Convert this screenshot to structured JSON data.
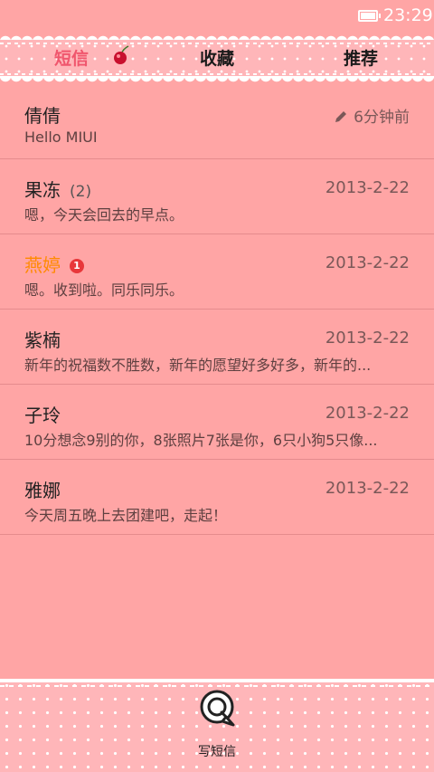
{
  "status_bar": {
    "time": "23:29",
    "battery_icon": "battery-icon"
  },
  "tabs": [
    {
      "label": "短信",
      "active": true
    },
    {
      "label": "收藏",
      "active": false
    },
    {
      "label": "推荐",
      "active": false
    }
  ],
  "messages": [
    {
      "contact": "倩倩",
      "snippet": "Hello MIUI",
      "time": "6分钟前",
      "draft": true
    },
    {
      "contact": "果冻",
      "count": "(2)",
      "snippet": "嗯，今天会回去的早点。",
      "date": "2013-2-22"
    },
    {
      "contact": "燕婷",
      "badge": "1",
      "unread": true,
      "snippet": "嗯。收到啦。同乐同乐。",
      "date": "2013-2-22"
    },
    {
      "contact": "紫楠",
      "snippet": "新年的祝福数不胜数，新年的愿望好多好多，新年的...",
      "date": "2013-2-22"
    },
    {
      "contact": "子玲",
      "snippet": "10分想念9别的你，8张照片7张是你，6只小狗5只像...",
      "date": "2013-2-22"
    },
    {
      "contact": "雅娜",
      "snippet": "今天周五晚上去团建吧，走起！",
      "date": "2013-2-22"
    }
  ],
  "compose": {
    "label": "写短信",
    "icon": "compose-message-icon"
  },
  "colors": {
    "background": "#ffa5a5",
    "accent": "#f0566d",
    "unread": "#ff8a00",
    "badge": "#e8373a"
  }
}
